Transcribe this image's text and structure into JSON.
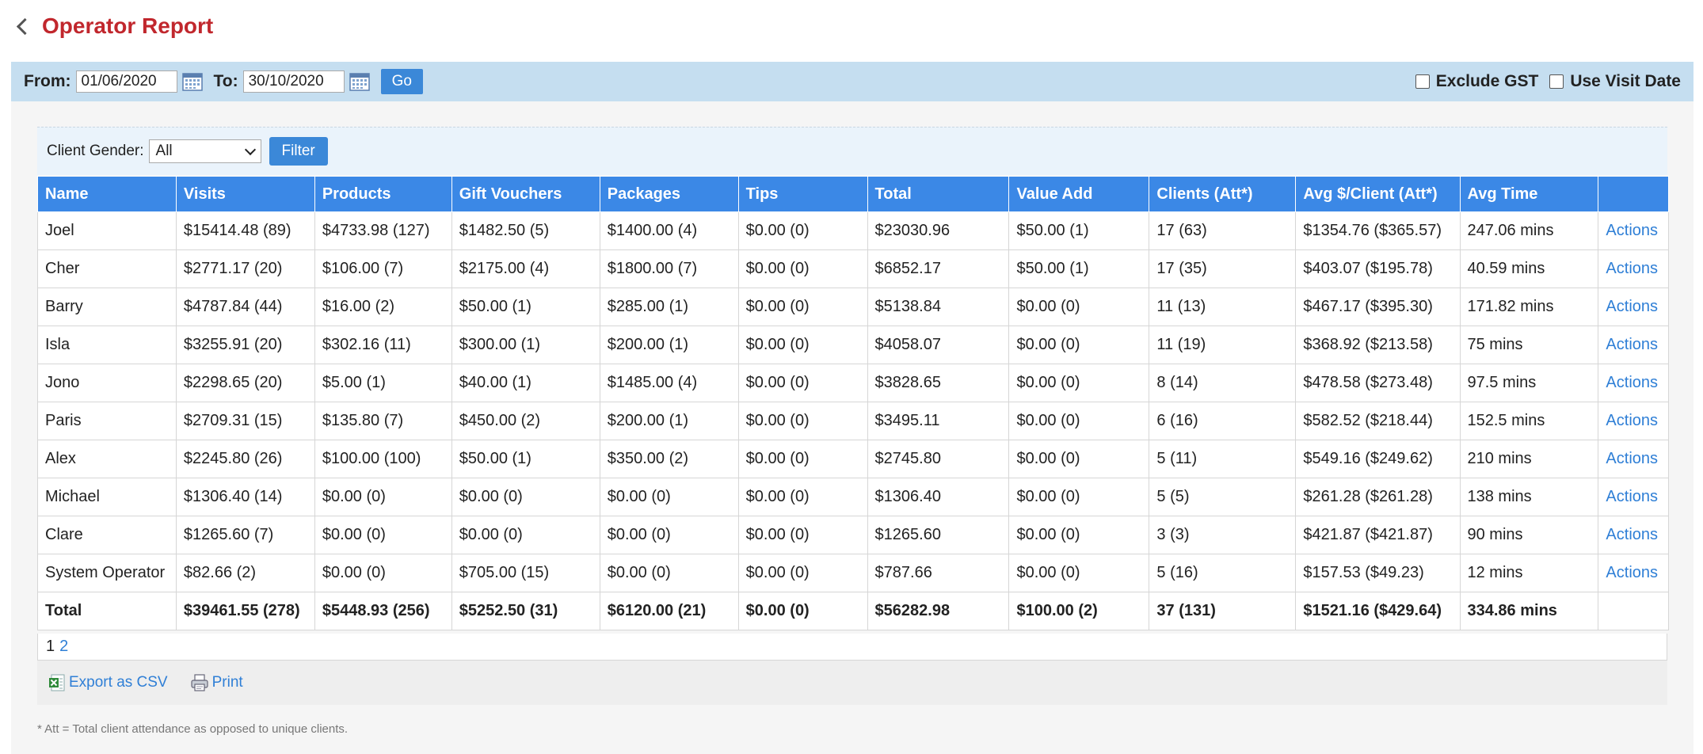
{
  "header": {
    "title": "Operator Report"
  },
  "toolbar": {
    "from_label": "From:",
    "from_value": "01/06/2020",
    "to_label": "To:",
    "to_value": "30/10/2020",
    "go_label": "Go",
    "exclude_gst_label": "Exclude GST",
    "use_visit_date_label": "Use Visit Date"
  },
  "filter": {
    "gender_label": "Client Gender:",
    "gender_value": "All",
    "filter_button": "Filter"
  },
  "table": {
    "headers": [
      "Name",
      "Visits",
      "Products",
      "Gift Vouchers",
      "Packages",
      "Tips",
      "Total",
      "Value Add",
      "Clients (Att*)",
      "Avg $/Client (Att*)",
      "Avg Time",
      ""
    ],
    "rows": [
      {
        "name": "Joel",
        "visits": "$15414.48 (89)",
        "products": "$4733.98 (127)",
        "gift_vouchers": "$1482.50 (5)",
        "packages": "$1400.00 (4)",
        "tips": "$0.00 (0)",
        "total": "$23030.96",
        "value_add": "$50.00 (1)",
        "clients": "17 (63)",
        "avg_client": "$1354.76 ($365.57)",
        "avg_time": "247.06 mins",
        "action": "Actions"
      },
      {
        "name": "Cher",
        "visits": "$2771.17 (20)",
        "products": "$106.00 (7)",
        "gift_vouchers": "$2175.00 (4)",
        "packages": "$1800.00 (7)",
        "tips": "$0.00 (0)",
        "total": "$6852.17",
        "value_add": "$50.00 (1)",
        "clients": "17 (35)",
        "avg_client": "$403.07 ($195.78)",
        "avg_time": "40.59 mins",
        "action": "Actions"
      },
      {
        "name": "Barry",
        "visits": "$4787.84 (44)",
        "products": "$16.00 (2)",
        "gift_vouchers": "$50.00 (1)",
        "packages": "$285.00 (1)",
        "tips": "$0.00 (0)",
        "total": "$5138.84",
        "value_add": "$0.00 (0)",
        "clients": "11 (13)",
        "avg_client": "$467.17 ($395.30)",
        "avg_time": "171.82 mins",
        "action": "Actions"
      },
      {
        "name": "Isla",
        "visits": "$3255.91 (20)",
        "products": "$302.16 (11)",
        "gift_vouchers": "$300.00 (1)",
        "packages": "$200.00 (1)",
        "tips": "$0.00 (0)",
        "total": "$4058.07",
        "value_add": "$0.00 (0)",
        "clients": "11 (19)",
        "avg_client": "$368.92 ($213.58)",
        "avg_time": "75 mins",
        "action": "Actions"
      },
      {
        "name": "Jono",
        "visits": "$2298.65 (20)",
        "products": "$5.00 (1)",
        "gift_vouchers": "$40.00 (1)",
        "packages": "$1485.00 (4)",
        "tips": "$0.00 (0)",
        "total": "$3828.65",
        "value_add": "$0.00 (0)",
        "clients": "8 (14)",
        "avg_client": "$478.58 ($273.48)",
        "avg_time": "97.5 mins",
        "action": "Actions"
      },
      {
        "name": "Paris",
        "visits": "$2709.31 (15)",
        "products": "$135.80 (7)",
        "gift_vouchers": "$450.00 (2)",
        "packages": "$200.00 (1)",
        "tips": "$0.00 (0)",
        "total": "$3495.11",
        "value_add": "$0.00 (0)",
        "clients": "6 (16)",
        "avg_client": "$582.52 ($218.44)",
        "avg_time": "152.5 mins",
        "action": "Actions"
      },
      {
        "name": "Alex",
        "visits": "$2245.80 (26)",
        "products": "$100.00 (100)",
        "gift_vouchers": "$50.00 (1)",
        "packages": "$350.00 (2)",
        "tips": "$0.00 (0)",
        "total": "$2745.80",
        "value_add": "$0.00 (0)",
        "clients": "5 (11)",
        "avg_client": "$549.16 ($249.62)",
        "avg_time": "210 mins",
        "action": "Actions"
      },
      {
        "name": "Michael",
        "visits": "$1306.40 (14)",
        "products": "$0.00 (0)",
        "gift_vouchers": "$0.00 (0)",
        "packages": "$0.00 (0)",
        "tips": "$0.00 (0)",
        "total": "$1306.40",
        "value_add": "$0.00 (0)",
        "clients": "5 (5)",
        "avg_client": "$261.28 ($261.28)",
        "avg_time": "138 mins",
        "action": "Actions"
      },
      {
        "name": "Clare",
        "visits": "$1265.60 (7)",
        "products": "$0.00 (0)",
        "gift_vouchers": "$0.00 (0)",
        "packages": "$0.00 (0)",
        "tips": "$0.00 (0)",
        "total": "$1265.60",
        "value_add": "$0.00 (0)",
        "clients": "3 (3)",
        "avg_client": "$421.87 ($421.87)",
        "avg_time": "90 mins",
        "action": "Actions"
      },
      {
        "name": "System Operator",
        "visits": "$82.66 (2)",
        "products": "$0.00 (0)",
        "gift_vouchers": "$705.00 (15)",
        "packages": "$0.00 (0)",
        "tips": "$0.00 (0)",
        "total": "$787.66",
        "value_add": "$0.00 (0)",
        "clients": "5 (16)",
        "avg_client": "$157.53 ($49.23)",
        "avg_time": "12 mins",
        "action": "Actions"
      }
    ],
    "total": {
      "name": "Total",
      "visits": "$39461.55 (278)",
      "products": "$5448.93 (256)",
      "gift_vouchers": "$5252.50 (31)",
      "packages": "$6120.00 (21)",
      "tips": "$0.00 (0)",
      "total": "$56282.98",
      "value_add": "$100.00 (2)",
      "clients": "37 (131)",
      "avg_client": "$1521.16 ($429.64)",
      "avg_time": "334.86 mins"
    }
  },
  "pagination": {
    "current": "1",
    "next": "2"
  },
  "export": {
    "csv_label": "Export as CSV",
    "print_label": "Print"
  },
  "footnote": "* Att = Total client attendance as opposed to unique clients.",
  "colors": {
    "title": "#c1272d",
    "toolbar_bg": "#c5def0",
    "header_bg": "#3b88e6",
    "link": "#2f7fd6",
    "button": "#3b88d8"
  },
  "icons": [
    "back-chevron-icon",
    "calendar-icon",
    "chevron-down-icon",
    "csv-icon",
    "printer-icon"
  ]
}
